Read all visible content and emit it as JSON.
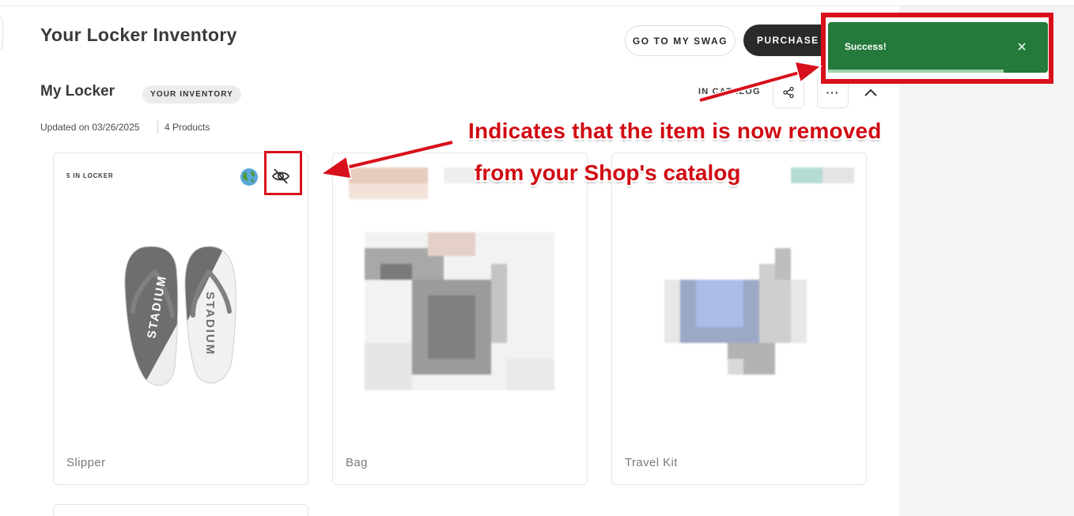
{
  "page": {
    "title": "Your Locker Inventory"
  },
  "header": {
    "go_to_swag": "GO TO MY SWAG",
    "purchase": "PURCHASE S"
  },
  "locker": {
    "title": "My Locker",
    "badge": "YOUR INVENTORY",
    "updated": "Updated on 03/26/2025",
    "count": "4 Products",
    "in_catalog": "IN CATALOG",
    "more_label": "···"
  },
  "products": [
    {
      "name": "Slipper",
      "stock": "5 IN LOCKER",
      "brand_text": "STADIUM",
      "status_icons": [
        "globe-icon",
        "eye-off-icon"
      ]
    },
    {
      "name": "Bag"
    },
    {
      "name": "Travel Kit"
    }
  ],
  "annotation": {
    "line1": "Indicates that the item is now removed",
    "line2": "from your Shop's catalog"
  },
  "toast": {
    "text": "Success!"
  },
  "colors": {
    "annotation_red": "#d8101b",
    "toast_green": "#237a3b",
    "dark_button": "#2a2a2a"
  }
}
